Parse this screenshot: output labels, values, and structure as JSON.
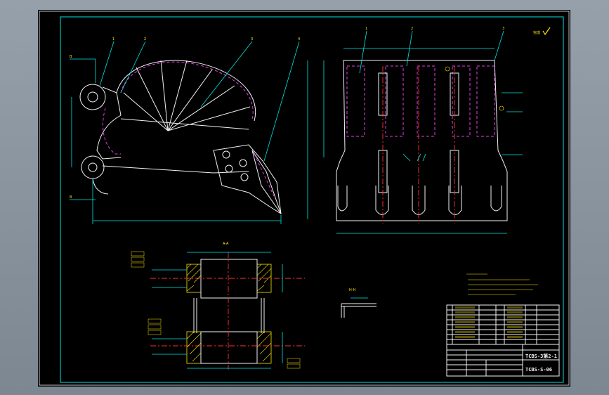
{
  "drawing": {
    "signature_label": "完成",
    "section_label": "A-A",
    "detail_label": "H-H",
    "title_block": {
      "drawing_no_main": "TCBS-3第2-1",
      "drawing_no_sub": "TCBS-S-06"
    }
  },
  "colors": {
    "background": "#000000",
    "frame": "#00e5e5",
    "outline": "#f2f2f2",
    "hidden": "#e040e0",
    "center": "#ff3030",
    "text": "#ffe600",
    "check": "#ffe600"
  }
}
